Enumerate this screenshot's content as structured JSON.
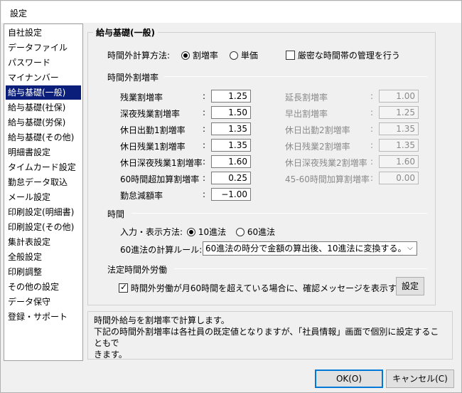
{
  "window": {
    "title": "設定"
  },
  "sidebar": {
    "items": [
      {
        "label": "自社設定"
      },
      {
        "label": "データファイル"
      },
      {
        "label": "パスワード"
      },
      {
        "label": "マイナンバー"
      },
      {
        "label": "給与基礎(一般)",
        "selected": true
      },
      {
        "label": "給与基礎(社保)"
      },
      {
        "label": "給与基礎(労保)"
      },
      {
        "label": "給与基礎(その他)"
      },
      {
        "label": "明細書設定"
      },
      {
        "label": "タイムカード設定"
      },
      {
        "label": "勤怠データ取込"
      },
      {
        "label": "メール設定"
      },
      {
        "label": "印刷設定(明細書)"
      },
      {
        "label": "印刷設定(その他)"
      },
      {
        "label": "集計表設定"
      },
      {
        "label": "全般設定"
      },
      {
        "label": "印刷調整"
      },
      {
        "label": "その他の設定"
      },
      {
        "label": "データ保守"
      },
      {
        "label": "登録・サポート"
      }
    ]
  },
  "group": {
    "title": "給与基礎(一般)"
  },
  "calc_method": {
    "label": "時間外計算方法:",
    "option_rate": "割増率",
    "option_unit": "単価",
    "selected": "割増率",
    "strict_label": "厳密な時間帯の管理を行う",
    "strict_checked": false
  },
  "rates": {
    "section_title": "時間外割増率",
    "colon": ":",
    "left": [
      {
        "label": "残業割増率",
        "value": "1.25"
      },
      {
        "label": "深夜残業割増率",
        "value": "1.50"
      },
      {
        "label": "休日出勤1割増率",
        "value": "1.35"
      },
      {
        "label": "休日残業1割増率",
        "value": "1.35"
      },
      {
        "label": "休日深夜残業1割増率",
        "value": "1.60"
      },
      {
        "label": "60時間超加算割増率",
        "value": "0.25"
      },
      {
        "label": "勤怠減額率",
        "value": "−1.00"
      }
    ],
    "right": [
      {
        "label": "延長割増率",
        "value": "1.00"
      },
      {
        "label": "早出割増率",
        "value": "1.25"
      },
      {
        "label": "休日出勤2割増率",
        "value": "1.35"
      },
      {
        "label": "休日残業2割増率",
        "value": "1.35"
      },
      {
        "label": "休日深夜残業2割増率",
        "value": "1.60"
      },
      {
        "label": "45-60時間加算割増率",
        "value": "0.00"
      }
    ]
  },
  "time": {
    "section_title": "時間",
    "input_label": "入力・表示方法:",
    "option_decimal": "10進法",
    "option_sexagesimal": "60進法",
    "selected": "10進法",
    "rule_label": "60進法の計算ルール:",
    "rule_value": "60進法の時分で金額の算出後、10進法に変換する。"
  },
  "legal": {
    "section_title": "法定時間外労働",
    "check_label": "時間外労働が月60時間を超えている場合に、確認メッセージを表示する",
    "checked": true,
    "settings_button": "設定"
  },
  "description": {
    "line1": "時間外給与を割増率で計算します。",
    "line2": "下記の時間外割増率は各社員の既定値となりますが、「社員情報」画面で個別に設定することもで",
    "line3": "きます。"
  },
  "footer": {
    "ok": "OK(O)",
    "cancel": "キャンセル(C)"
  }
}
